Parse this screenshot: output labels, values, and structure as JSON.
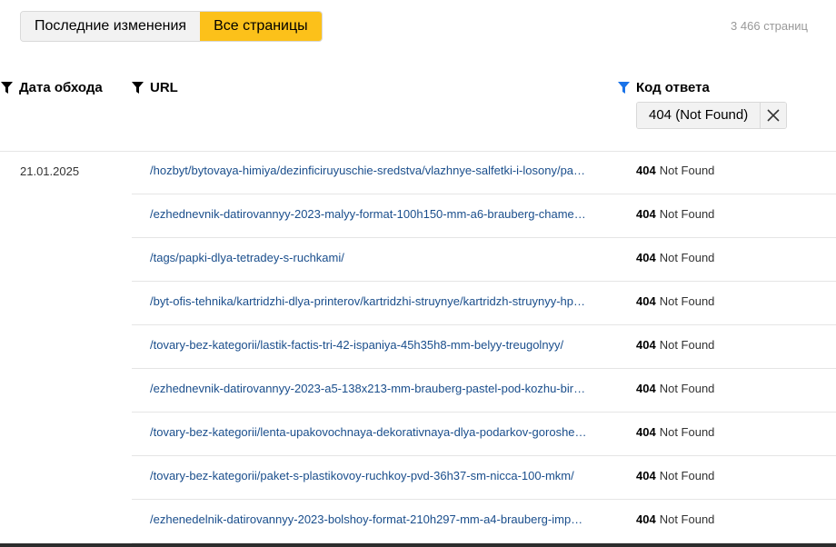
{
  "tabs": {
    "recent_label": "Последние изменения",
    "all_label": "Все страницы"
  },
  "pages_count": "3 466 страниц",
  "columns": {
    "date": "Дата обхода",
    "url": "URL",
    "code": "Код ответа"
  },
  "code_filter": {
    "chip_label": "404 (Not Found)"
  },
  "group_date": "21.01.2025",
  "rows": [
    {
      "url": "/hozbyt/bytovaya-himiya/dezinficiruyuschie-sredstva/vlazhnye-salfetki-i-losony/pa…",
      "code": "404",
      "status": "Not Found"
    },
    {
      "url": "/ezhednevnik-datirovannyy-2023-malyy-format-100h150-mm-a6-brauberg-chame…",
      "code": "404",
      "status": "Not Found"
    },
    {
      "url": "/tags/papki-dlya-tetradey-s-ruchkami/",
      "code": "404",
      "status": "Not Found"
    },
    {
      "url": "/byt-ofis-tehnika/kartridzhi-dlya-printerov/kartridzhi-struynye/kartridzh-struynyy-hp…",
      "code": "404",
      "status": "Not Found"
    },
    {
      "url": "/tovary-bez-kategorii/lastik-factis-tri-42-ispaniya-45h35h8-mm-belyy-treugolnyy/",
      "code": "404",
      "status": "Not Found"
    },
    {
      "url": "/ezhednevnik-datirovannyy-2023-a5-138x213-mm-brauberg-pastel-pod-kozhu-bir…",
      "code": "404",
      "status": "Not Found"
    },
    {
      "url": "/tovary-bez-kategorii/lenta-upakovochnaya-dekorativnaya-dlya-podarkov-goroshe…",
      "code": "404",
      "status": "Not Found"
    },
    {
      "url": "/tovary-bez-kategorii/paket-s-plastikovoy-ruchkoy-pvd-36h37-sm-nicca-100-mkm/",
      "code": "404",
      "status": "Not Found"
    },
    {
      "url": "/ezhenedelnik-datirovannyy-2023-bolshoy-format-210h297-mm-a4-brauberg-imp…",
      "code": "404",
      "status": "Not Found"
    }
  ],
  "colors": {
    "accent_tab": "#fcc11a",
    "link": "#1a4e8c",
    "active_filter_icon": "#1a73e8"
  }
}
